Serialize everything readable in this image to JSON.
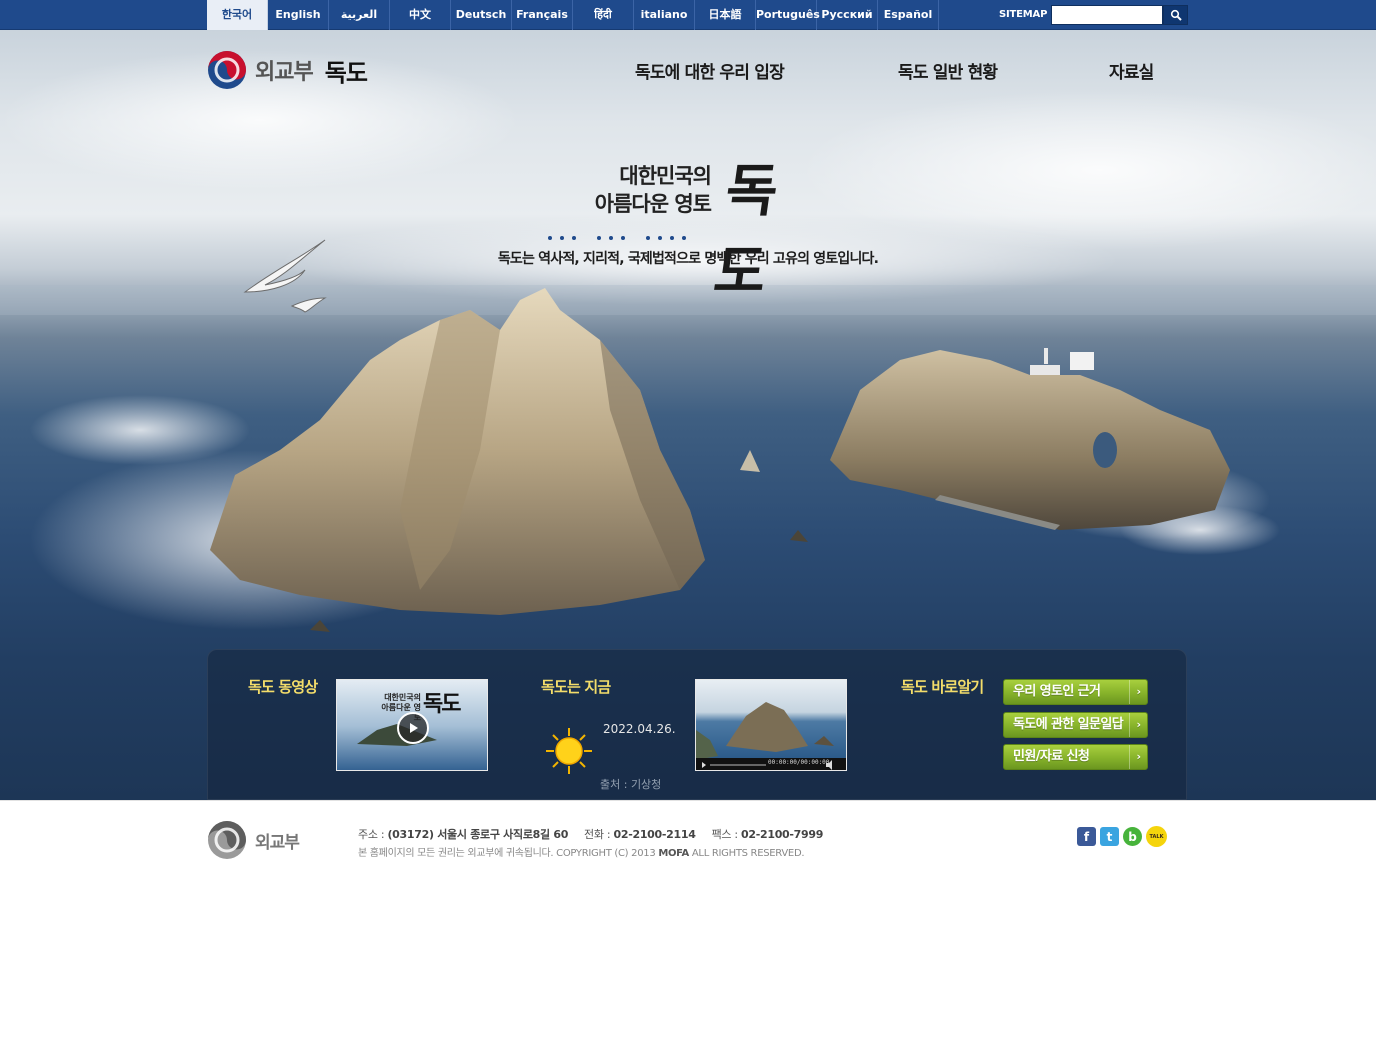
{
  "languages": [
    {
      "label": "한국어",
      "active": true
    },
    {
      "label": "English"
    },
    {
      "label": "العربية"
    },
    {
      "label": "中文"
    },
    {
      "label": "Deutsch"
    },
    {
      "label": "Français"
    },
    {
      "label": "हिंदी"
    },
    {
      "label": "italiano"
    },
    {
      "label": "日本語"
    },
    {
      "label": "Português"
    },
    {
      "label": "Русский"
    },
    {
      "label": "Español"
    }
  ],
  "header": {
    "sitemap_label": "SITEMAP",
    "search_value": "",
    "search_icon": "magnifier-icon",
    "logo_ministry": "외교부",
    "logo_site": "독도"
  },
  "nav": {
    "items": [
      "독도에 대한 우리 입장",
      "독도 일반 현황",
      "자료실"
    ]
  },
  "hero": {
    "title_line1": "대한민국의",
    "title_line2": "아름다운 영토",
    "title_big": "독도",
    "tagline": "독도는 역사적, 지리적, 국제법적으로 명백한 우리 고유의 영토입니다."
  },
  "panel": {
    "video": {
      "title": "독도 동영상",
      "thumb_caption_small": "대한민국의 아름다운 영토",
      "thumb_caption_big": "독도",
      "play_icon": "play-icon"
    },
    "now": {
      "title": "독도는 지금",
      "date": "2022.04.26.",
      "weather_icon": "sun-icon",
      "source": "출처 : 기상청",
      "player_time": "00:00:00/00:00:00"
    },
    "know": {
      "title": "독도 바로알기",
      "buttons": [
        "우리 영토인 근거",
        "독도에 관한 일문일답",
        "민원/자료 신청"
      ]
    }
  },
  "footer": {
    "logo_text": "외교부",
    "address_label": "주소 :",
    "address": "(03172) 서울시 종로구 사직로8길 60",
    "phone_label": "전화 :",
    "phone": "02-2100-2114",
    "fax_label": "팩스 :",
    "fax": "02-2100-7999",
    "copyright_ko": "본 홈페이지의 모든 권리는 외교부에 귀속됩니다.",
    "copyright_en_pre": "COPYRIGHT (C)  2013",
    "copyright_en_brand": "MOFA",
    "copyright_en_post": "ALL RIGHTS RESERVED.",
    "social": [
      {
        "icon": "facebook-icon",
        "glyph": "f",
        "color": "#3b5998"
      },
      {
        "icon": "twitter-icon",
        "glyph": "t",
        "color": "#3aa4e0"
      },
      {
        "icon": "band-icon",
        "glyph": "b",
        "color": "#47b33b"
      },
      {
        "icon": "kakaotalk-icon",
        "glyph": "TALK",
        "color": "#f5d40c"
      }
    ]
  },
  "colors": {
    "top_bar": "#1f4a8c",
    "panel_title": "#f3dd6a",
    "button_green": "#86b22a"
  }
}
